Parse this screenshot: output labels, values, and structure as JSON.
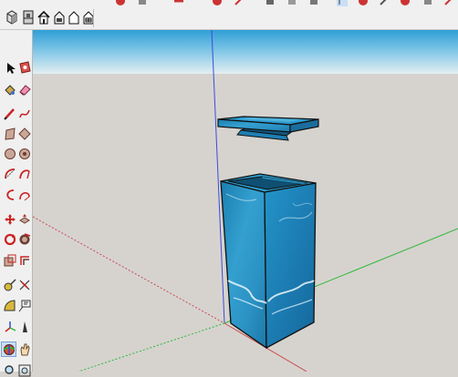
{
  "app": "SketchUp",
  "view_toolbar": {
    "icons": [
      "iso-view-icon",
      "top-view-icon",
      "home-front-view-icon",
      "house-right-view-icon",
      "house-back-view-icon",
      "house-left-view-icon"
    ]
  },
  "tools": [
    {
      "name": "select-tool",
      "icon": "arrow-icon"
    },
    {
      "name": "make-component-tool",
      "icon": "component-icon"
    },
    {
      "name": "paint-bucket-tool",
      "icon": "paint-bucket-icon"
    },
    {
      "name": "eraser-tool",
      "icon": "eraser-icon"
    },
    {
      "name": "line-tool",
      "icon": "pencil-icon"
    },
    {
      "name": "freehand-tool",
      "icon": "freehand-icon"
    },
    {
      "name": "rectangle-tool",
      "icon": "rectangle-icon"
    },
    {
      "name": "rotated-rectangle-tool",
      "icon": "rotated-rectangle-icon"
    },
    {
      "name": "circle-tool",
      "icon": "circle-icon"
    },
    {
      "name": "polygon-tool",
      "icon": "polygon-icon"
    },
    {
      "name": "arc-tool",
      "icon": "arc-icon"
    },
    {
      "name": "pie-tool",
      "icon": "pie-icon"
    },
    {
      "name": "two-point-arc-tool",
      "icon": "two-point-arc-icon"
    },
    {
      "name": "three-point-arc-tool",
      "icon": "three-point-arc-icon"
    },
    {
      "name": "move-tool",
      "icon": "move-icon"
    },
    {
      "name": "push-pull-tool",
      "icon": "push-pull-icon"
    },
    {
      "name": "rotate-tool",
      "icon": "rotate-icon"
    },
    {
      "name": "follow-me-tool",
      "icon": "follow-me-icon"
    },
    {
      "name": "scale-tool",
      "icon": "scale-icon"
    },
    {
      "name": "offset-tool",
      "icon": "offset-icon"
    },
    {
      "name": "tape-measure-tool",
      "icon": "tape-measure-icon"
    },
    {
      "name": "dimension-tool",
      "icon": "dimension-icon"
    },
    {
      "name": "protractor-tool",
      "icon": "protractor-icon"
    },
    {
      "name": "text-tool",
      "icon": "text-icon"
    },
    {
      "name": "axes-tool",
      "icon": "axes-icon"
    },
    {
      "name": "3d-text-tool",
      "icon": "3d-text-icon"
    },
    {
      "name": "orbit-tool",
      "icon": "orbit-icon",
      "active": true
    },
    {
      "name": "pan-tool",
      "icon": "hand-icon"
    },
    {
      "name": "zoom-tool",
      "icon": "zoom-icon"
    },
    {
      "name": "zoom-window-tool",
      "icon": "zoom-window-icon"
    }
  ],
  "colors": {
    "sky_top": "#2f9fd6",
    "sky_bottom": "#e4eef1",
    "ground": "#d6d3cf",
    "axis_blue": "#3b4dd6",
    "axis_green": "#2db838",
    "axis_red": "#cc4c4c",
    "box_face": "#2a8fbd",
    "box_side": "#1e76a6",
    "box_inner": "#0f4f72"
  }
}
